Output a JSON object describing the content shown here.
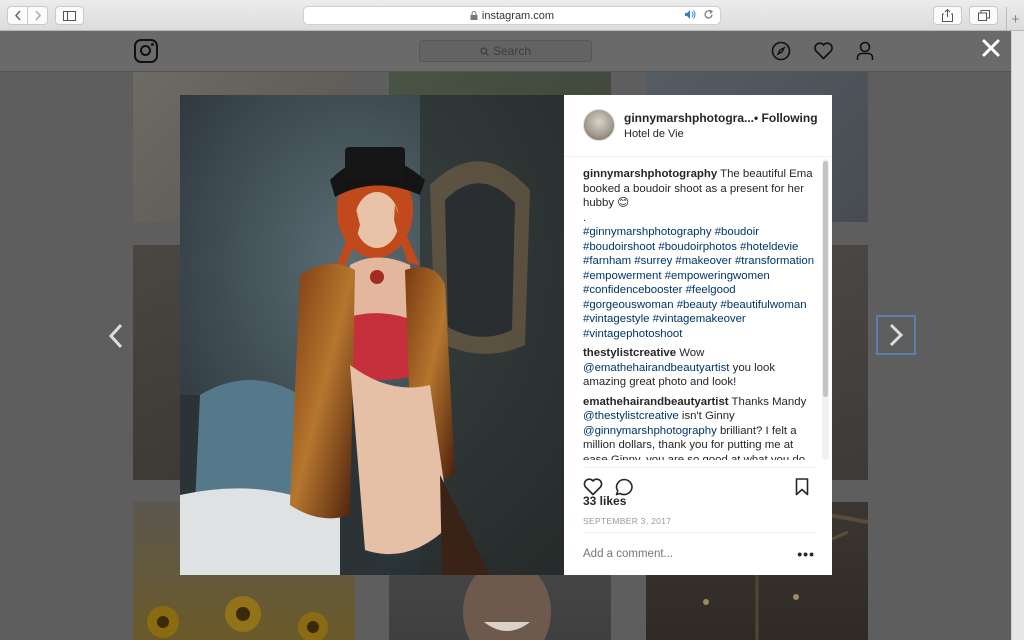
{
  "browser": {
    "url": "instagram.com",
    "new_tab_label": "+"
  },
  "instagram": {
    "search_placeholder": "Search"
  },
  "post": {
    "username": "ginnymarshphotogra...",
    "following_label": "• Following",
    "location": "Hotel de Vie",
    "likes": "33 likes",
    "date": "SEPTEMBER 3, 2017",
    "add_comment_placeholder": "Add a comment...",
    "more_label": "•••",
    "caption": {
      "author": "ginnymarshphotography",
      "text": " The beautiful Ema booked a boudoir shoot as a present for her hubby 😊",
      "dot": ".",
      "hashtags": "#ginnymarshphotography #boudoir #boudoirshoot #boudoirphotos #hoteldevie #farnham #surrey #makeover #transformation #empowerment #empoweringwomen #confidencebooster #feelgood #gorgeouswoman #beauty #beautifulwoman #vintagestyle #vintagemakeover #vintagephotoshoot"
    },
    "comments": [
      {
        "author": "thestylistcreative",
        "text_before": " Wow ",
        "mention": "@emathehairandbeautyartist",
        "text_after": " you look amazing great photo and look!"
      },
      {
        "author": "emathehairandbeautyartist",
        "text_before": " Thanks Mandy ",
        "mention": "@thestylistcreative",
        "text_mid": " isn't Ginny ",
        "mention2": "@ginnymarshphotography",
        "text_after": " brilliant? I felt a million dollars, thank you for putting me at ease Ginny, you are so good at what you do"
      }
    ]
  },
  "colors": {
    "link": "#003569",
    "text": "#262626",
    "overlay": "#5e5e5e"
  }
}
